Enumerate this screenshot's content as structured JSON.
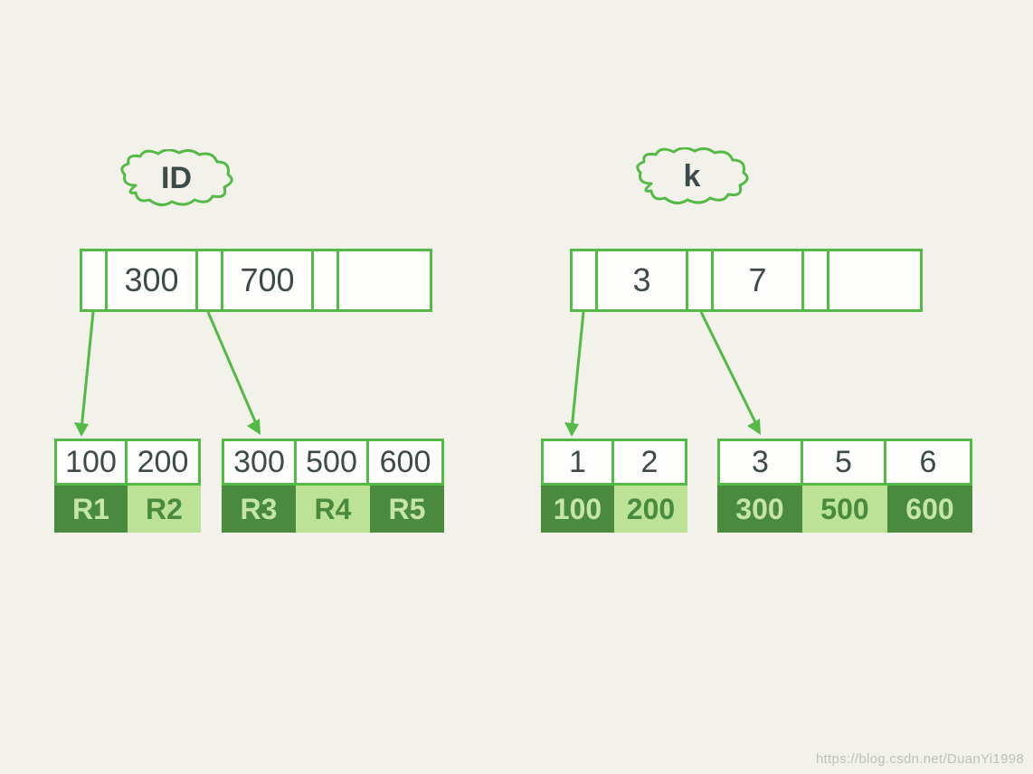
{
  "watermark": "https://blog.csdn.net/DuanYi1998",
  "left_tree": {
    "label": "ID",
    "root_keys": [
      "300",
      "700"
    ],
    "leaf1": {
      "keys": [
        "100",
        "200"
      ],
      "recs": [
        "R1",
        "R2"
      ],
      "shades": [
        "dark",
        "light"
      ]
    },
    "leaf2": {
      "keys": [
        "300",
        "500",
        "600"
      ],
      "recs": [
        "R3",
        "R4",
        "R5"
      ],
      "shades": [
        "dark",
        "light",
        "dark"
      ]
    }
  },
  "right_tree": {
    "label": "k",
    "root_keys": [
      "3",
      "7"
    ],
    "leaf1": {
      "keys": [
        "1",
        "2"
      ],
      "recs": [
        "100",
        "200"
      ],
      "shades": [
        "dark",
        "light"
      ]
    },
    "leaf2": {
      "keys": [
        "3",
        "5",
        "6"
      ],
      "recs": [
        "300",
        "500",
        "600"
      ],
      "shades": [
        "dark",
        "light",
        "dark"
      ]
    }
  }
}
